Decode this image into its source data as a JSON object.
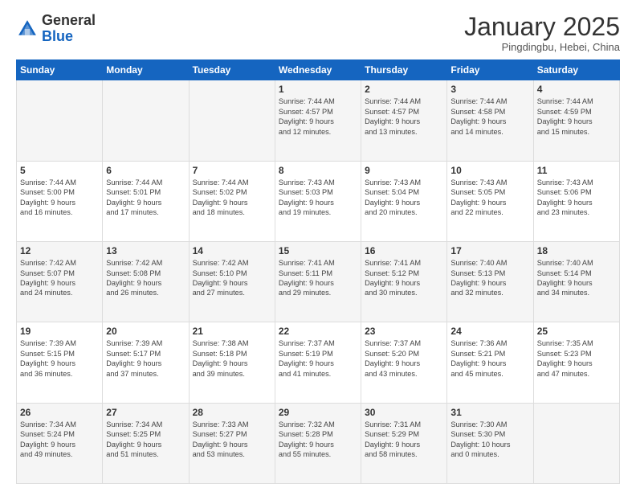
{
  "header": {
    "logo_general": "General",
    "logo_blue": "Blue",
    "month_title": "January 2025",
    "subtitle": "Pingdingbu, Hebei, China"
  },
  "days_of_week": [
    "Sunday",
    "Monday",
    "Tuesday",
    "Wednesday",
    "Thursday",
    "Friday",
    "Saturday"
  ],
  "weeks": [
    [
      {
        "num": "",
        "info": ""
      },
      {
        "num": "",
        "info": ""
      },
      {
        "num": "",
        "info": ""
      },
      {
        "num": "1",
        "info": "Sunrise: 7:44 AM\nSunset: 4:57 PM\nDaylight: 9 hours\nand 12 minutes."
      },
      {
        "num": "2",
        "info": "Sunrise: 7:44 AM\nSunset: 4:57 PM\nDaylight: 9 hours\nand 13 minutes."
      },
      {
        "num": "3",
        "info": "Sunrise: 7:44 AM\nSunset: 4:58 PM\nDaylight: 9 hours\nand 14 minutes."
      },
      {
        "num": "4",
        "info": "Sunrise: 7:44 AM\nSunset: 4:59 PM\nDaylight: 9 hours\nand 15 minutes."
      }
    ],
    [
      {
        "num": "5",
        "info": "Sunrise: 7:44 AM\nSunset: 5:00 PM\nDaylight: 9 hours\nand 16 minutes."
      },
      {
        "num": "6",
        "info": "Sunrise: 7:44 AM\nSunset: 5:01 PM\nDaylight: 9 hours\nand 17 minutes."
      },
      {
        "num": "7",
        "info": "Sunrise: 7:44 AM\nSunset: 5:02 PM\nDaylight: 9 hours\nand 18 minutes."
      },
      {
        "num": "8",
        "info": "Sunrise: 7:43 AM\nSunset: 5:03 PM\nDaylight: 9 hours\nand 19 minutes."
      },
      {
        "num": "9",
        "info": "Sunrise: 7:43 AM\nSunset: 5:04 PM\nDaylight: 9 hours\nand 20 minutes."
      },
      {
        "num": "10",
        "info": "Sunrise: 7:43 AM\nSunset: 5:05 PM\nDaylight: 9 hours\nand 22 minutes."
      },
      {
        "num": "11",
        "info": "Sunrise: 7:43 AM\nSunset: 5:06 PM\nDaylight: 9 hours\nand 23 minutes."
      }
    ],
    [
      {
        "num": "12",
        "info": "Sunrise: 7:42 AM\nSunset: 5:07 PM\nDaylight: 9 hours\nand 24 minutes."
      },
      {
        "num": "13",
        "info": "Sunrise: 7:42 AM\nSunset: 5:08 PM\nDaylight: 9 hours\nand 26 minutes."
      },
      {
        "num": "14",
        "info": "Sunrise: 7:42 AM\nSunset: 5:10 PM\nDaylight: 9 hours\nand 27 minutes."
      },
      {
        "num": "15",
        "info": "Sunrise: 7:41 AM\nSunset: 5:11 PM\nDaylight: 9 hours\nand 29 minutes."
      },
      {
        "num": "16",
        "info": "Sunrise: 7:41 AM\nSunset: 5:12 PM\nDaylight: 9 hours\nand 30 minutes."
      },
      {
        "num": "17",
        "info": "Sunrise: 7:40 AM\nSunset: 5:13 PM\nDaylight: 9 hours\nand 32 minutes."
      },
      {
        "num": "18",
        "info": "Sunrise: 7:40 AM\nSunset: 5:14 PM\nDaylight: 9 hours\nand 34 minutes."
      }
    ],
    [
      {
        "num": "19",
        "info": "Sunrise: 7:39 AM\nSunset: 5:15 PM\nDaylight: 9 hours\nand 36 minutes."
      },
      {
        "num": "20",
        "info": "Sunrise: 7:39 AM\nSunset: 5:17 PM\nDaylight: 9 hours\nand 37 minutes."
      },
      {
        "num": "21",
        "info": "Sunrise: 7:38 AM\nSunset: 5:18 PM\nDaylight: 9 hours\nand 39 minutes."
      },
      {
        "num": "22",
        "info": "Sunrise: 7:37 AM\nSunset: 5:19 PM\nDaylight: 9 hours\nand 41 minutes."
      },
      {
        "num": "23",
        "info": "Sunrise: 7:37 AM\nSunset: 5:20 PM\nDaylight: 9 hours\nand 43 minutes."
      },
      {
        "num": "24",
        "info": "Sunrise: 7:36 AM\nSunset: 5:21 PM\nDaylight: 9 hours\nand 45 minutes."
      },
      {
        "num": "25",
        "info": "Sunrise: 7:35 AM\nSunset: 5:23 PM\nDaylight: 9 hours\nand 47 minutes."
      }
    ],
    [
      {
        "num": "26",
        "info": "Sunrise: 7:34 AM\nSunset: 5:24 PM\nDaylight: 9 hours\nand 49 minutes."
      },
      {
        "num": "27",
        "info": "Sunrise: 7:34 AM\nSunset: 5:25 PM\nDaylight: 9 hours\nand 51 minutes."
      },
      {
        "num": "28",
        "info": "Sunrise: 7:33 AM\nSunset: 5:27 PM\nDaylight: 9 hours\nand 53 minutes."
      },
      {
        "num": "29",
        "info": "Sunrise: 7:32 AM\nSunset: 5:28 PM\nDaylight: 9 hours\nand 55 minutes."
      },
      {
        "num": "30",
        "info": "Sunrise: 7:31 AM\nSunset: 5:29 PM\nDaylight: 9 hours\nand 58 minutes."
      },
      {
        "num": "31",
        "info": "Sunrise: 7:30 AM\nSunset: 5:30 PM\nDaylight: 10 hours\nand 0 minutes."
      },
      {
        "num": "",
        "info": ""
      }
    ]
  ]
}
